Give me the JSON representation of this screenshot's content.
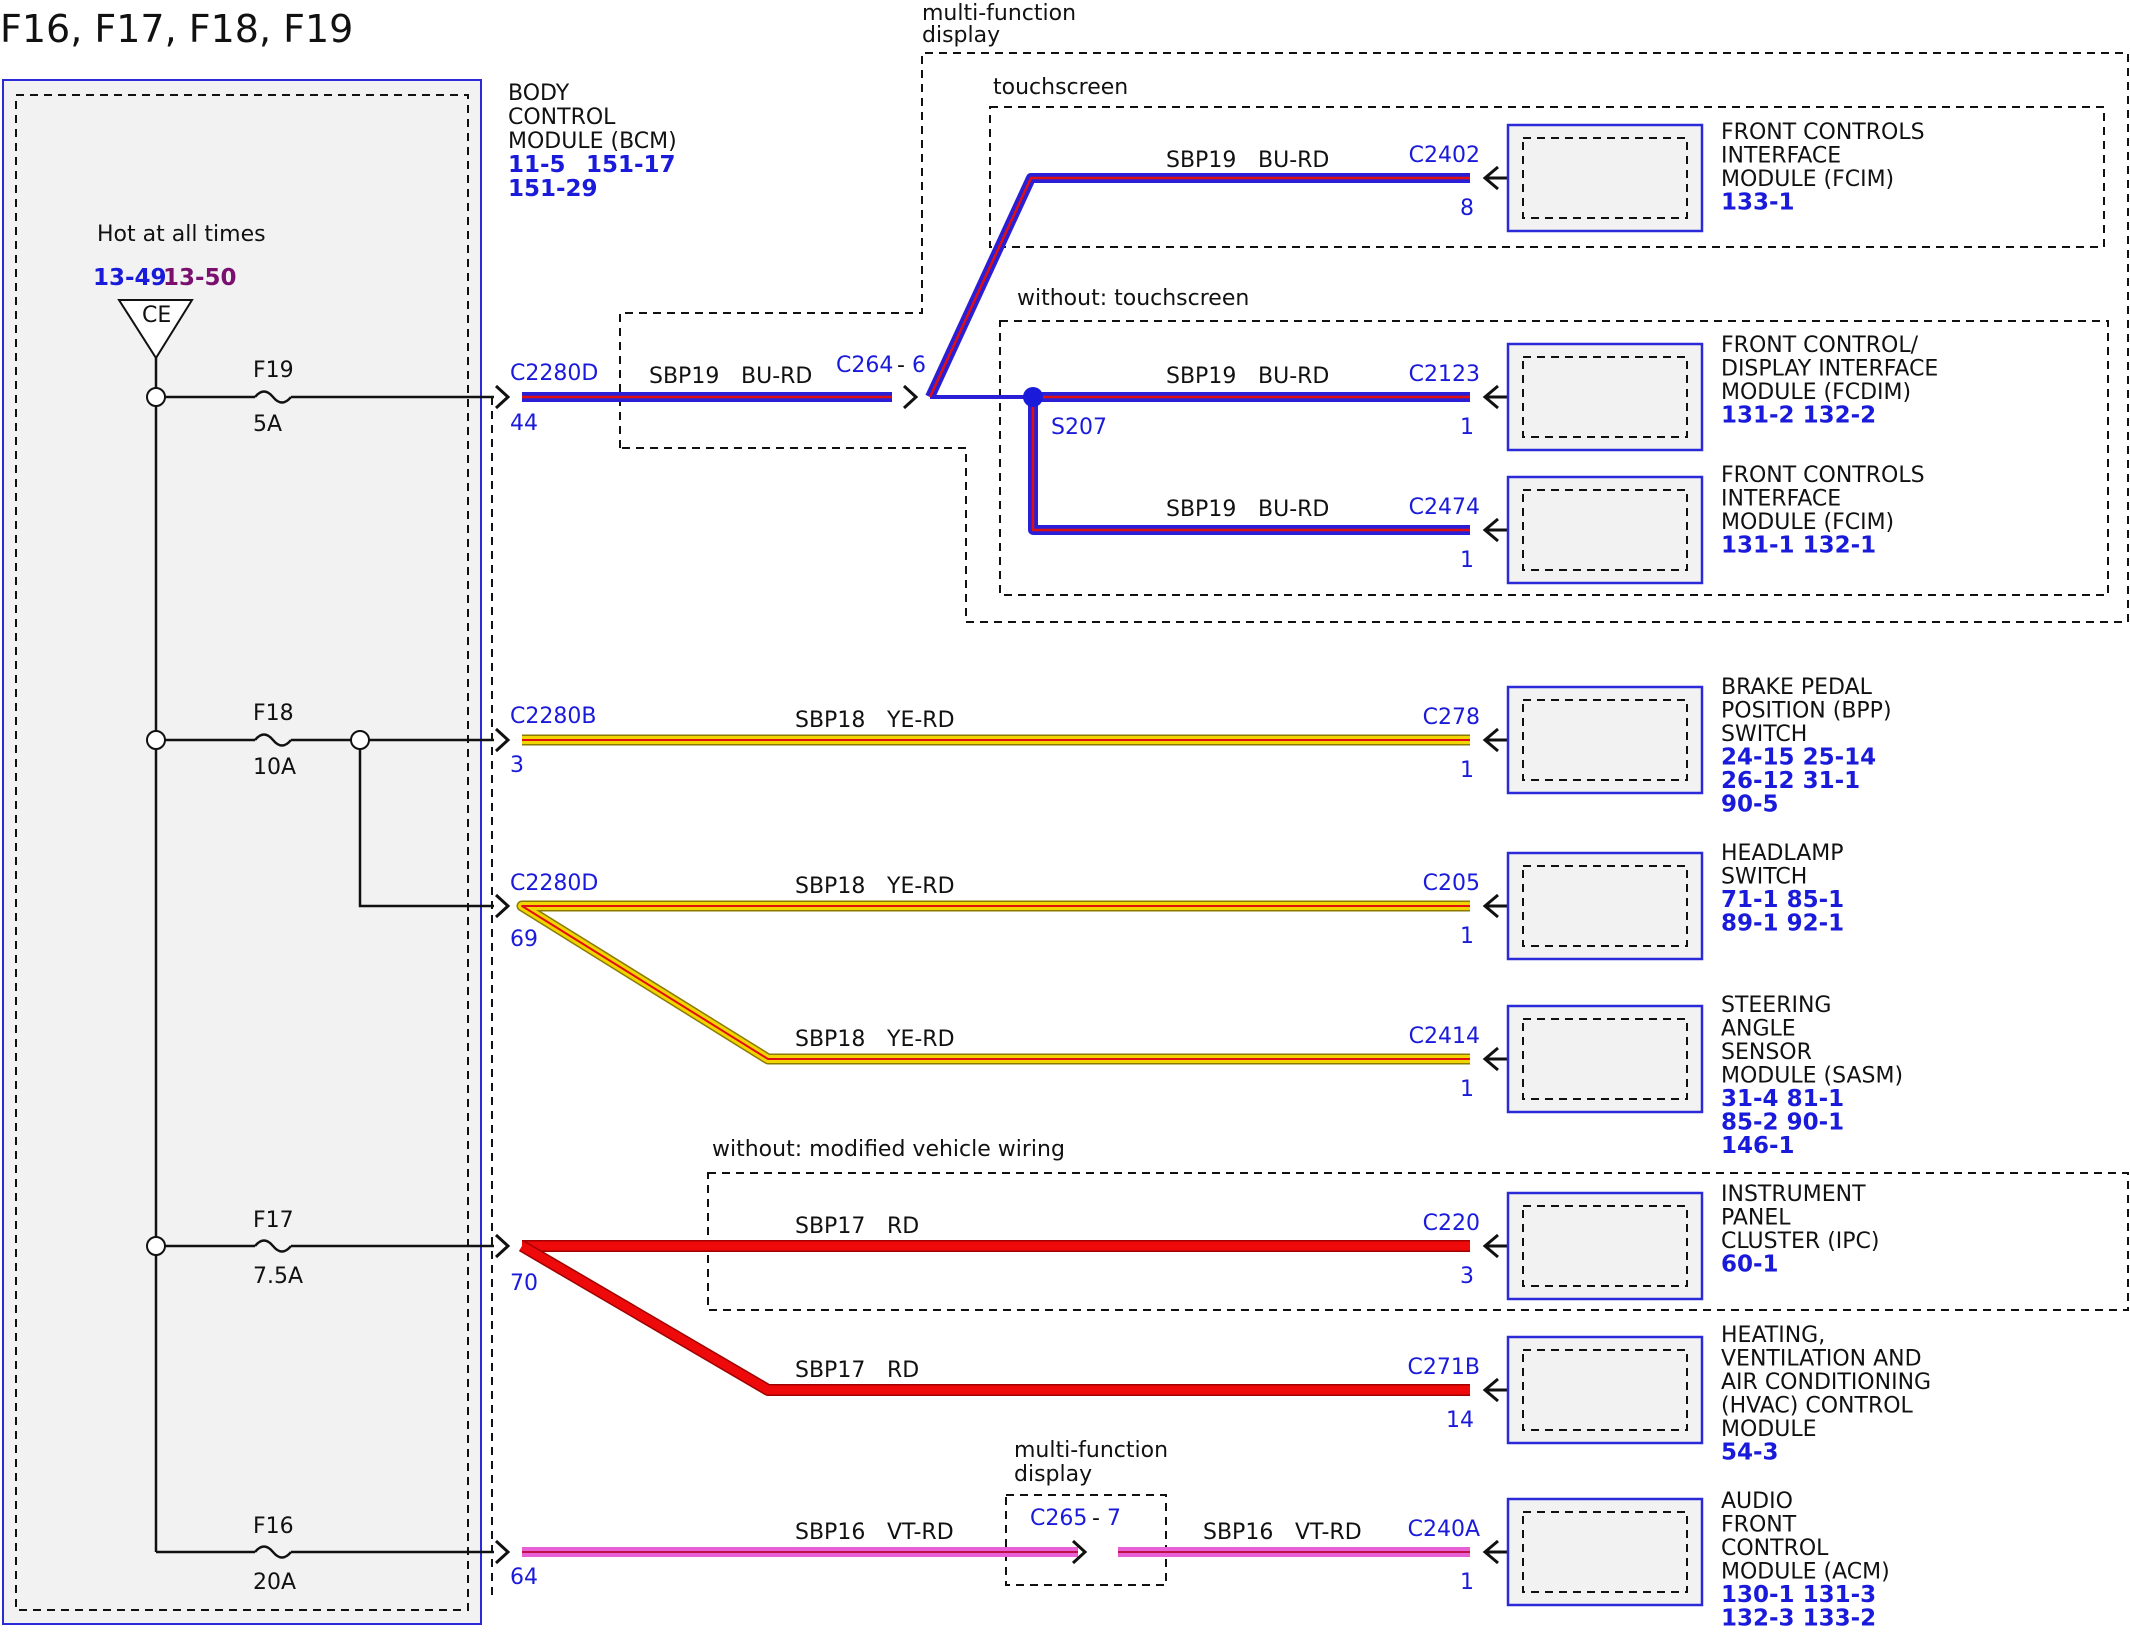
{
  "title": "F16, F17, F18, F19",
  "power": {
    "label": "Hot at all times",
    "refs": [
      "13-49",
      "13-50"
    ],
    "bus": "CE"
  },
  "bcm": {
    "lines": [
      "BODY",
      "CONTROL",
      "MODULE (BCM)"
    ],
    "refs": [
      "11-5",
      "151-17",
      "151-29"
    ]
  },
  "fuses": [
    {
      "name": "F19",
      "rating": "5A"
    },
    {
      "name": "F18",
      "rating": "10A"
    },
    {
      "name": "F17",
      "rating": "7.5A"
    },
    {
      "name": "F16",
      "rating": "20A"
    }
  ],
  "bcm_pins": [
    {
      "connector": "C2280D",
      "pin": "44"
    },
    {
      "connector": "C2280B",
      "pin": "3"
    },
    {
      "connector": "C2280D",
      "pin": "69"
    },
    {
      "connector": "",
      "pin": "70"
    },
    {
      "connector": "",
      "pin": "64"
    }
  ],
  "groups": {
    "mfd_top": [
      "multi-function",
      "display"
    ],
    "touchscreen": "touchscreen",
    "without_touchscreen": "without: touchscreen",
    "without_modified": "without: modified vehicle wiring",
    "mfd_bottom": [
      "multi-function",
      "display"
    ]
  },
  "inline_connectors": {
    "c264": {
      "name": "C264",
      "sep": "-",
      "pin": "6"
    },
    "c265": {
      "name": "C265",
      "sep": "-",
      "pin": "7"
    }
  },
  "splice": "S207",
  "wires": [
    {
      "circuit": "SBP19",
      "color": "BU-RD"
    },
    {
      "circuit": "SBP19",
      "color": "BU-RD"
    },
    {
      "circuit": "SBP19",
      "color": "BU-RD"
    },
    {
      "circuit": "SBP19",
      "color": "BU-RD"
    },
    {
      "circuit": "SBP18",
      "color": "YE-RD"
    },
    {
      "circuit": "SBP18",
      "color": "YE-RD"
    },
    {
      "circuit": "SBP18",
      "color": "YE-RD"
    },
    {
      "circuit": "SBP17",
      "color": "RD"
    },
    {
      "circuit": "SBP17",
      "color": "RD"
    },
    {
      "circuit": "SBP16",
      "color": "VT-RD"
    },
    {
      "circuit": "SBP16",
      "color": "VT-RD"
    }
  ],
  "modules": [
    {
      "connector": "C2402",
      "pin": "8",
      "lines": [
        "FRONT CONTROLS",
        "INTERFACE",
        "MODULE (FCIM)"
      ],
      "refs": [
        "133-1"
      ]
    },
    {
      "connector": "C2123",
      "pin": "1",
      "lines": [
        "FRONT CONTROL/",
        "DISPLAY INTERFACE",
        "MODULE (FCDIM)"
      ],
      "refs": [
        "131-2 132-2"
      ]
    },
    {
      "connector": "C2474",
      "pin": "1",
      "lines": [
        "FRONT CONTROLS",
        "INTERFACE",
        "MODULE (FCIM)"
      ],
      "refs": [
        "131-1 132-1"
      ]
    },
    {
      "connector": "C278",
      "pin": "1",
      "lines": [
        "BRAKE PEDAL",
        "POSITION (BPP)",
        "SWITCH"
      ],
      "refs": [
        "24-15 25-14",
        "26-12 31-1",
        "90-5"
      ]
    },
    {
      "connector": "C205",
      "pin": "1",
      "lines": [
        "HEADLAMP",
        "SWITCH"
      ],
      "refs": [
        "71-1  85-1",
        "89-1  92-1"
      ]
    },
    {
      "connector": "C2414",
      "pin": "1",
      "lines": [
        "STEERING",
        "ANGLE",
        "SENSOR",
        "MODULE (SASM)"
      ],
      "refs": [
        "31-4  81-1",
        "85-2  90-1",
        "146-1"
      ]
    },
    {
      "connector": "C220",
      "pin": "3",
      "lines": [
        "INSTRUMENT",
        "PANEL",
        "CLUSTER (IPC)"
      ],
      "refs": [
        "60-1"
      ]
    },
    {
      "connector": "C271B",
      "pin": "14",
      "lines": [
        "HEATING,",
        "VENTILATION AND",
        "AIR CONDITIONING",
        "(HVAC) CONTROL",
        "MODULE"
      ],
      "refs": [
        "54-3"
      ]
    },
    {
      "connector": "C240A",
      "pin": "1",
      "lines": [
        "AUDIO",
        "FRONT",
        "CONTROL",
        "MODULE (ACM)"
      ],
      "refs": [
        "130-1 131-3",
        "132-3 133-2"
      ]
    }
  ],
  "colors": {
    "blue_wire": "#2a1fd6",
    "red_stripe": "#e01010",
    "yellow_wire": "#f2d400",
    "red_wire": "#ee0a0a",
    "violet_wire": "#e860d6",
    "ref_blue": "#1a1adb",
    "ref_purple": "#7a0f6e",
    "module_fill": "#f2f2f2"
  }
}
